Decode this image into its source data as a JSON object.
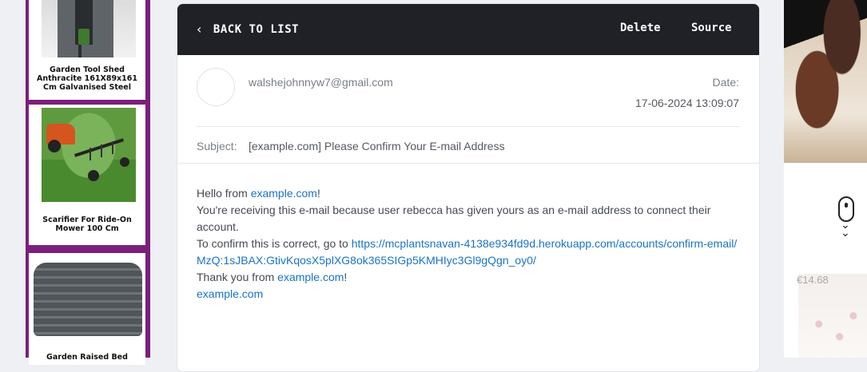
{
  "left_ads": [
    {
      "title": "Garden Tool Shed Anthracite 161X89x161 Cm Galvanised Steel"
    },
    {
      "title": "Scarifier For Ride-On Mower 100 Cm"
    },
    {
      "title": "Garden Raised Bed"
    }
  ],
  "toolbar": {
    "back_label": "BACK TO LIST",
    "delete_label": "Delete",
    "source_label": "Source"
  },
  "email": {
    "from": "walshejohnnyw7@gmail.com",
    "date_label": "Date:",
    "date": "17-06-2024 13:09:07",
    "subject_label": "Subject:",
    "subject": "[example.com] Please Confirm Your E-mail Address",
    "body": {
      "hello": "Hello from ",
      "site": "example.com",
      "exclaim": "!",
      "line2": "You're receiving this e-mail because user rebecca has given yours as an e-mail address to connect their account.",
      "line3": "To confirm this is correct, go to ",
      "confirm_link": "https://mcplantsnavan-4138e934fd9d.herokuapp.com/accounts/confirm-email/MzQ:1sJBAX:GtivKqosX5plXG8ok365SIGp5KMHIyc3Gl9gQgn_oy0/",
      "thanks": "Thank you from ",
      "site2": "example.com",
      "exclaim2": "!",
      "site3": "example.com"
    }
  },
  "right_ad": {
    "price": "€14.68"
  },
  "icons": {
    "back": "chevron-left-icon",
    "scroll": "mouse-scroll-icon"
  }
}
